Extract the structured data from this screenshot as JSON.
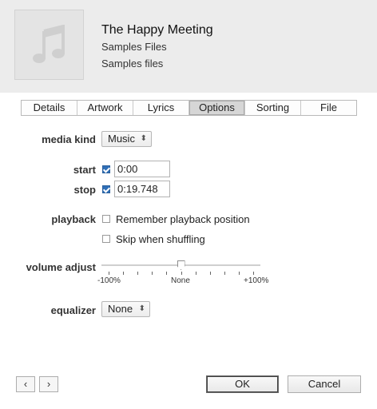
{
  "header": {
    "title": "The Happy Meeting",
    "line1": "Samples Files",
    "line2": "Samples files"
  },
  "tabs": [
    {
      "label": "Details"
    },
    {
      "label": "Artwork"
    },
    {
      "label": "Lyrics"
    },
    {
      "label": "Options",
      "active": true
    },
    {
      "label": "Sorting"
    },
    {
      "label": "File"
    }
  ],
  "options": {
    "media_kind_label": "media kind",
    "media_kind_value": "Music",
    "start_label": "start",
    "start_checked": true,
    "start_value": "0:00",
    "stop_label": "stop",
    "stop_checked": true,
    "stop_value": "0:19.748",
    "playback_label": "playback",
    "remember_label": "Remember playback position",
    "remember_checked": false,
    "skip_label": "Skip when shuffling",
    "skip_checked": false,
    "volume_label": "volume adjust",
    "volume_min": "-100%",
    "volume_mid": "None",
    "volume_max": "+100%",
    "volume_percent": 0,
    "equalizer_label": "equalizer",
    "equalizer_value": "None"
  },
  "footer": {
    "prev_icon": "‹",
    "next_icon": "›",
    "ok_label": "OK",
    "cancel_label": "Cancel"
  }
}
